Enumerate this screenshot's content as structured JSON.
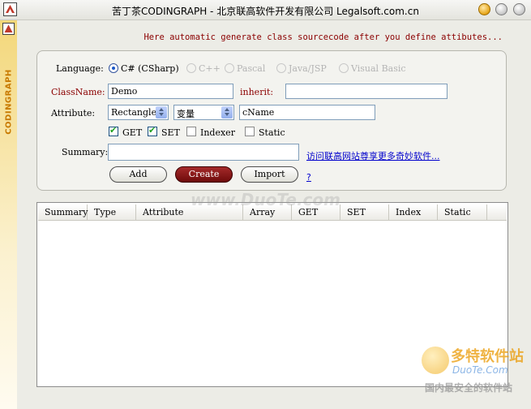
{
  "window": {
    "title": "苦丁茶CODINGRAPH - 北京联高软件开发有限公司 Legalsoft.com.cn"
  },
  "sidebar": {
    "brand": "CODINGRAPH"
  },
  "hint": "Here automatic generate class sourcecode after you define attibutes...",
  "form": {
    "language_label": "Language:",
    "languages": [
      {
        "label": "C# (CSharp)",
        "selected": true,
        "enabled": true
      },
      {
        "label": "C++",
        "selected": false,
        "enabled": false
      },
      {
        "label": "Pascal",
        "selected": false,
        "enabled": false
      },
      {
        "label": "Java/JSP",
        "selected": false,
        "enabled": false
      },
      {
        "label": "Visual Basic",
        "selected": false,
        "enabled": false
      }
    ],
    "classname_label": "ClassName:",
    "classname_value": "Demo",
    "inherit_label": "inherit:",
    "inherit_value": "",
    "attribute_label": "Attribute:",
    "attribute_type": "Rectangle",
    "attribute_kind": "变量",
    "attribute_name": "cName",
    "checkboxes": [
      {
        "label": "GET",
        "checked": true
      },
      {
        "label": "SET",
        "checked": true
      },
      {
        "label": "Indexer",
        "checked": false
      },
      {
        "label": "Static",
        "checked": false
      }
    ],
    "summary_label": "Summary:",
    "summary_value": "",
    "visit_link": "访问联高网站尊享更多奇妙软件...",
    "help_link": "?",
    "buttons": {
      "add": "Add",
      "create": "Create",
      "import": "Import"
    }
  },
  "grid": {
    "columns": [
      "Summary",
      "Type",
      "Attribute",
      "Array",
      "GET",
      "SET",
      "Index",
      "Static"
    ],
    "rows": []
  },
  "watermark": {
    "center": "www.DuoTe.com",
    "brand": "多特软件站",
    "site": "DuoTe.Com",
    "slogan": "国内最安全的软件站"
  },
  "colors": {
    "accent": "#8b0000",
    "link": "#0000cc"
  }
}
